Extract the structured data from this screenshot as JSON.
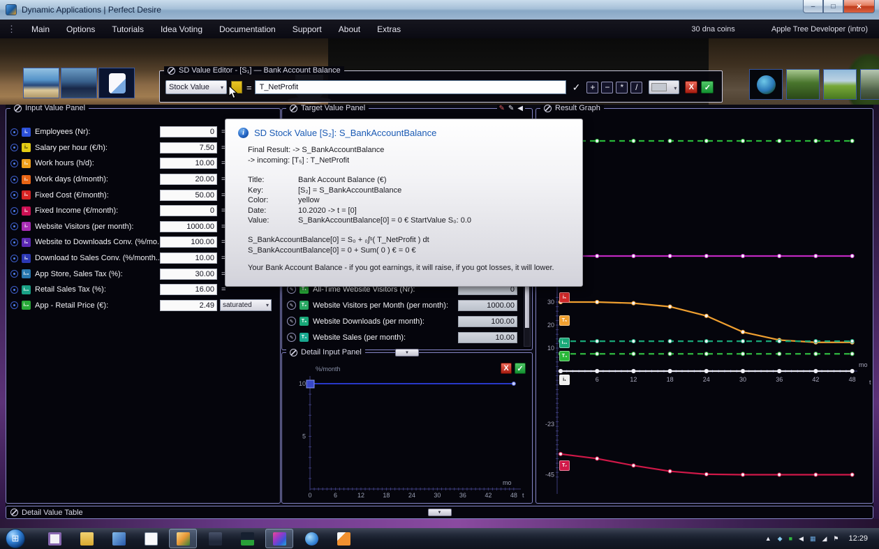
{
  "window": {
    "title": "Dynamic Applications | Perfect Desire",
    "minimize": "–",
    "maximize": "□",
    "close": "×"
  },
  "menubar": {
    "items": [
      "Main",
      "Options",
      "Tutorials",
      "Idea Voting",
      "Documentation",
      "Support",
      "About",
      "Extras"
    ],
    "coins": "30 dna coins",
    "account": "Apple Tree Developer (intro)"
  },
  "value_editor": {
    "title": "SD Value Editor - [S₁]  —  Bank Account Balance",
    "type_selector": "Stock Value",
    "stock_color": "#e8c424",
    "equals": "=",
    "formula": "T_NetProfit",
    "check": "✓",
    "ops": [
      "+",
      "−",
      "*",
      "/"
    ],
    "color_swatch": "#c4c8d0",
    "cancel": "X",
    "ok": "✓"
  },
  "input_panel": {
    "title": "Input Value Panel",
    "rows": [
      {
        "icon": "i₁",
        "color": "#2c50d8",
        "fg": "#ffffff",
        "label": "Employees (Nr):",
        "value": "0",
        "suffix": "="
      },
      {
        "icon": "i₂",
        "color": "#e4cc14",
        "fg": "#2a2a10",
        "label": "Salary per hour (€/h):",
        "value": "7.50",
        "suffix": "="
      },
      {
        "icon": "i₃",
        "color": "#f0a01c",
        "fg": "#ffffff",
        "label": "Work hours (h/d):",
        "value": "10.00",
        "suffix": "="
      },
      {
        "icon": "i₄",
        "color": "#e86414",
        "fg": "#ffffff",
        "label": "Work days (d/month):",
        "value": "20.00",
        "suffix": "="
      },
      {
        "icon": "i₅",
        "color": "#d82424",
        "fg": "#ffffff",
        "label": "Fixed Cost (€/month):",
        "value": "50.00",
        "suffix": "="
      },
      {
        "icon": "i₆",
        "color": "#cc1054",
        "fg": "#ffffff",
        "label": "Fixed Income (€/month):",
        "value": "0",
        "suffix": "="
      },
      {
        "icon": "i₇",
        "color": "#a82cb4",
        "fg": "#ffffff",
        "label": "Website Visitors (per month):",
        "value": "1000.00",
        "suffix": "="
      },
      {
        "icon": "i₈",
        "color": "#5c28b4",
        "fg": "#ffffff",
        "label": "Website to Downloads Conv. (%/mo...",
        "value": "100.00",
        "suffix": "="
      },
      {
        "icon": "i₉",
        "color": "#2c38b4",
        "fg": "#ffffff",
        "label": "Download to Sales Conv. (%/month...",
        "value": "10.00",
        "suffix": "="
      },
      {
        "icon": "i₁₀",
        "color": "#2878b0",
        "fg": "#ffffff",
        "label": "App Store, Sales Tax (%):",
        "value": "30.00",
        "suffix": "="
      },
      {
        "icon": "i₁₁",
        "color": "#18a085",
        "fg": "#ffffff",
        "label": "Retail Sales Tax (%):",
        "value": "16.00",
        "suffix": "="
      },
      {
        "icon": "i₁₂",
        "color": "#28a838",
        "fg": "#ffffff",
        "label": "App - Retail Price (€):",
        "value": "2.49",
        "dropdown": "saturated"
      }
    ]
  },
  "tooltip": {
    "title": "SD Stock Value  [S₂]:  S_BankAccountBalance",
    "line1": "Final Result:  ->  S_BankAccountBalance",
    "line2": "->  incoming:   [T₅] :  T_NetProfit",
    "fields": [
      {
        "k": "Title:",
        "v": "Bank Account Balance (€)"
      },
      {
        "k": "Key:",
        "v": "[S₂] = S_BankAccountBalance"
      },
      {
        "k": "Color:",
        "v": "yellow"
      },
      {
        "k": "Date:",
        "v": "10.2020  ->  t = [0]"
      },
      {
        "k": "Value:",
        "v": "S_BankAccountBalance[0] = 0 €   StartValue S₀:  0.0"
      }
    ],
    "formula1": "S_BankAccountBalance[0]  =  S₀ + ₀∫ˢ( T_NetProfit ) dt",
    "formula2": "S_BankAccountBalance[0]  =  0 + Sum( 0 ) €  =  0 €",
    "footer": "Your Bank Account Balance - if you got earnings, it will raise, if you got losses, it will lower."
  },
  "target_panel": {
    "title": "Target Value Panel",
    "rows": [
      {
        "icon": "T₁",
        "color": "#28a838",
        "fg": "#ffffff",
        "label": "All-Time Website Visitors (Nr):",
        "value": "0"
      },
      {
        "icon": "T₂",
        "color": "#28a862",
        "fg": "#ffffff",
        "label": "Website Visitors per Month (per month):",
        "value": "1000.00"
      },
      {
        "icon": "T₃",
        "color": "#18a878",
        "fg": "#ffffff",
        "label": "Website Downloads (per month):",
        "value": "100.00"
      },
      {
        "icon": "T₄",
        "color": "#18a890",
        "fg": "#ffffff",
        "label": "Website Sales (per month):",
        "value": "10.00"
      }
    ]
  },
  "detail_panel": {
    "title": "Detail Input Panel",
    "unit": "%/month",
    "yticks": [
      "10",
      "5"
    ],
    "xticks": [
      "0",
      "6",
      "12",
      "18",
      "24",
      "30",
      "36",
      "42",
      "48"
    ],
    "xunit": "mo",
    "xvar": "t",
    "cancel": "X",
    "ok": "✓"
  },
  "result_graph": {
    "title": "Result Graph",
    "yticks_pos": [
      "30",
      "20",
      "10"
    ],
    "yticks_neg": [
      "-23",
      "-45"
    ],
    "xticks": [
      "6",
      "12",
      "18",
      "24",
      "30",
      "36",
      "42",
      "48"
    ],
    "xunit": "mo",
    "xvar": "t",
    "legend": [
      {
        "label": "i₅",
        "color": "#d02828",
        "fg": "#ffffff"
      },
      {
        "label": "T₅",
        "color": "#f0a030",
        "fg": "#ffffff"
      },
      {
        "label": "i₁₁",
        "color": "#18a878",
        "fg": "#ffffff"
      },
      {
        "label": "T₄",
        "color": "#28b838",
        "fg": "#ffffff"
      },
      {
        "label": "i₁",
        "color": "#f0f0f0",
        "fg": "#101010"
      },
      {
        "label": "T₇",
        "color": "#d01848",
        "fg": "#ffffff"
      }
    ]
  },
  "detail_table": {
    "title": "Detail Value Table"
  },
  "taskbar": {
    "time": "12:29",
    "buttons": [
      {
        "name": "presentation"
      },
      {
        "name": "folder"
      },
      {
        "name": "window"
      },
      {
        "name": "document"
      },
      {
        "name": "photo-viewer",
        "active": true
      },
      {
        "name": "image"
      },
      {
        "name": "chart"
      },
      {
        "name": "sd-app",
        "active": true
      },
      {
        "name": "browser"
      },
      {
        "name": "pencil"
      }
    ],
    "tray": [
      {
        "name": "hidden-icons-icon",
        "glyph": "▲",
        "color": "#e8e8f0"
      },
      {
        "name": "status-diamond-icon",
        "glyph": "◆",
        "color": "#86c8ec"
      },
      {
        "name": "status-stop-icon",
        "glyph": "■",
        "color": "#30b840"
      },
      {
        "name": "volume-icon",
        "glyph": "◀",
        "color": "#e8e8f0"
      },
      {
        "name": "display-icon",
        "glyph": "▦",
        "color": "#6aa8e0"
      },
      {
        "name": "network-icon",
        "glyph": "◢",
        "color": "#e8e8f0"
      },
      {
        "name": "action-center-icon",
        "glyph": "⚑",
        "color": "#e8e8f0"
      }
    ]
  },
  "chart_data": [
    {
      "type": "line",
      "title": "Result Graph",
      "xlabel": "t (mo)",
      "ylabel": "",
      "x": [
        0,
        6,
        12,
        18,
        24,
        30,
        36,
        42,
        48
      ],
      "xlim": [
        0,
        48
      ],
      "ylim": [
        -50,
        110
      ],
      "grid": false,
      "legend_position": "left-inside",
      "series": [
        {
          "name": "green constant (top)",
          "color": "#28b838",
          "dashed": true,
          "values": [
            100,
            100,
            100,
            100,
            100,
            100,
            100,
            100,
            100
          ]
        },
        {
          "name": "magenta constant",
          "color": "#c028c0",
          "dashed": false,
          "values": [
            50,
            50,
            50,
            50,
            50,
            50,
            50,
            50,
            50
          ]
        },
        {
          "name": "T₅ orange declining",
          "color": "#f0a030",
          "dashed": false,
          "values": [
            30,
            30,
            29.5,
            28,
            24,
            17,
            13.5,
            12.5,
            12.5
          ]
        },
        {
          "name": "i₁₁ teal constant",
          "color": "#18a878",
          "dashed": true,
          "values": [
            13,
            13,
            13,
            13,
            13,
            13,
            13,
            13,
            13
          ]
        },
        {
          "name": "T₄ green constant",
          "color": "#30b840",
          "dashed": true,
          "values": [
            7.5,
            7.5,
            7.5,
            7.5,
            7.5,
            7.5,
            7.5,
            7.5,
            7.5
          ]
        },
        {
          "name": "i₁ zero line",
          "color": "#e8e8f0",
          "dashed": false,
          "values": [
            0,
            0,
            0,
            0,
            0,
            0,
            0,
            0,
            0
          ]
        },
        {
          "name": "T₇ crimson declining",
          "color": "#d01848",
          "dashed": false,
          "values": [
            -36,
            -38,
            -41,
            -43.5,
            -44.8,
            -45,
            -45,
            -45,
            -45
          ]
        }
      ]
    },
    {
      "type": "line",
      "title": "Detail Input Panel",
      "xlabel": "t (mo)",
      "ylabel": "%/month",
      "x": [
        0,
        48
      ],
      "xlim": [
        0,
        48
      ],
      "ylim": [
        0,
        12
      ],
      "grid": false,
      "series": [
        {
          "name": "input curve",
          "color": "#2838c8",
          "dashed": false,
          "values": [
            10,
            10
          ]
        }
      ]
    }
  ]
}
